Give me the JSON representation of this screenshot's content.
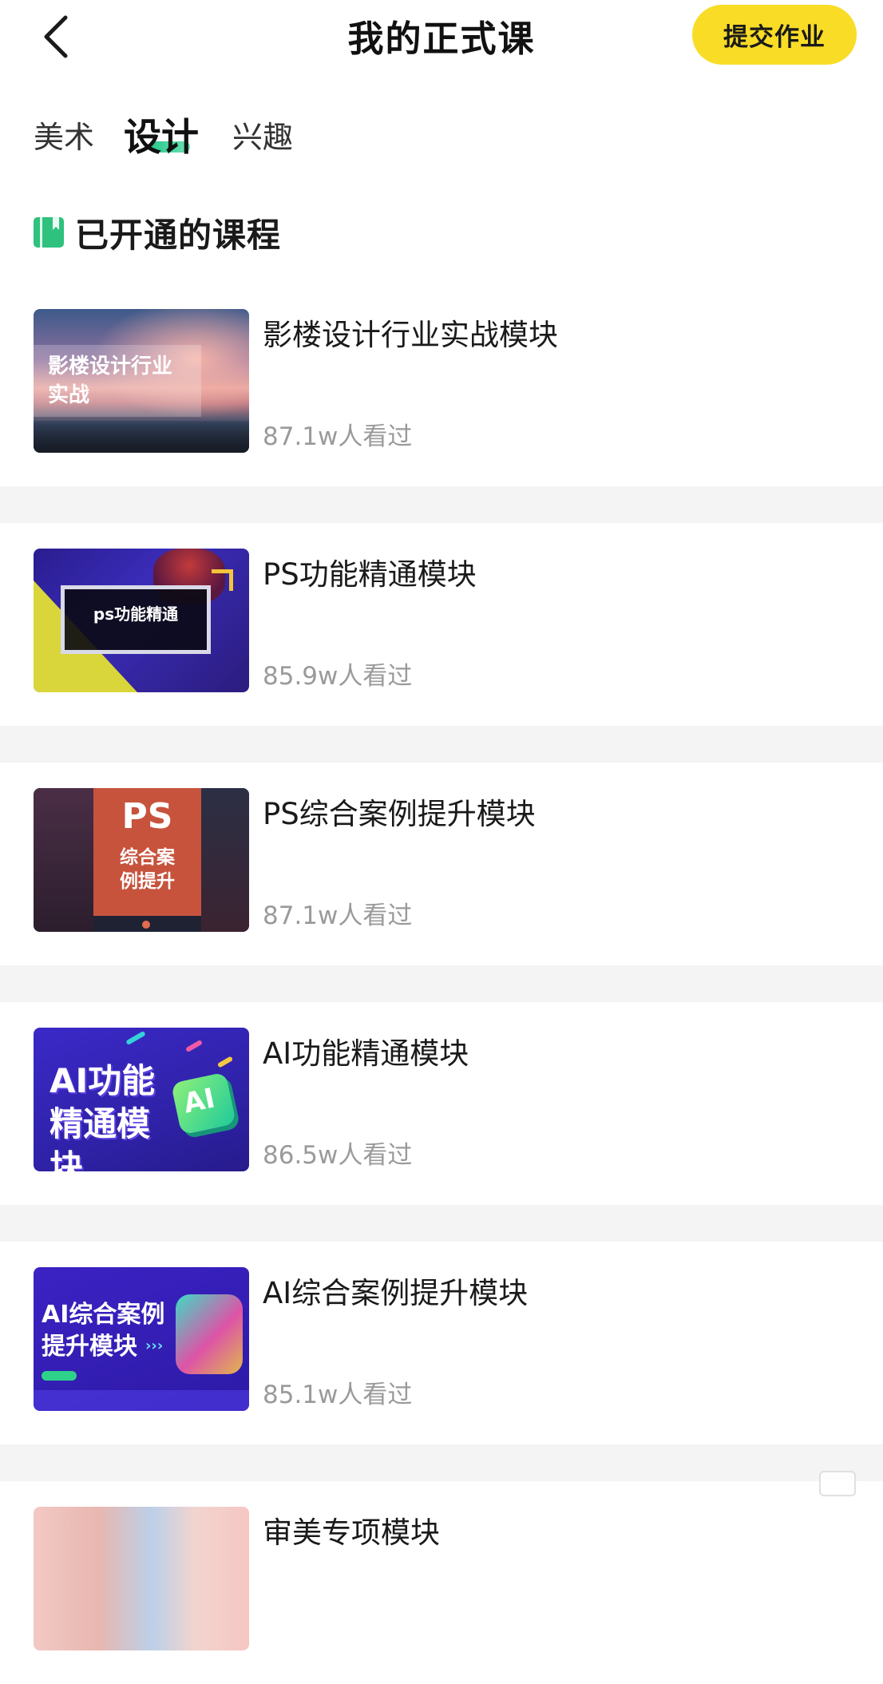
{
  "header": {
    "title": "我的正式课",
    "submit_label": "提交作业"
  },
  "tabs": [
    {
      "label": "美术",
      "active": false
    },
    {
      "label": "设计",
      "active": true
    },
    {
      "label": "兴趣",
      "active": false
    }
  ],
  "section": {
    "title": "已开通的课程",
    "icon": "book-icon",
    "icon_color": "#2ec27e"
  },
  "courses": [
    {
      "title": "影楼设计行业实战模块",
      "views": "87.1w人看过",
      "thumb_text": "影楼设计行业实战"
    },
    {
      "title": "PS功能精通模块",
      "views": "85.9w人看过",
      "thumb_text": "ps功能精通"
    },
    {
      "title": "PS综合案例提升模块",
      "views": "87.1w人看过",
      "thumb_heading": "PS",
      "thumb_text": "综合案例提升"
    },
    {
      "title": "AI功能精通模块",
      "views": "86.5w人看过",
      "thumb_text": "AI功能精通模块",
      "thumb_badge": "AI"
    },
    {
      "title": "AI综合案例提升模块",
      "views": "85.1w人看过",
      "thumb_text": "AI综合案例提升模块"
    },
    {
      "title": "审美专项模块",
      "views": ""
    }
  ],
  "colors": {
    "accent_yellow": "#f9dc26",
    "tab_underline": "#27c98a",
    "views_gray": "#9a9a9a",
    "separator": "#f4f4f4"
  }
}
